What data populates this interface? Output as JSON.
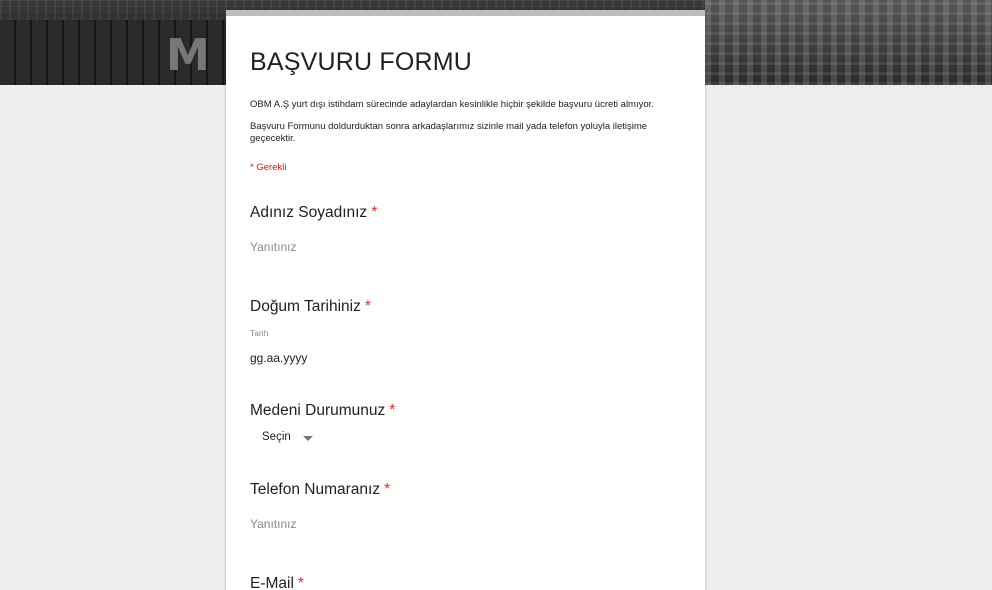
{
  "banner": {
    "letter": "M"
  },
  "form": {
    "title": "BAŞVURU FORMU",
    "description_1": "OBM A.Ş yurt dışı istihdam sürecinde adaylardan kesinlikle hiçbir şekilde başvuru ücreti almıyor.",
    "description_2": "Başvuru Formunu doldurduktan sonra arkadaşlarımız sizinle mail yada telefon yoluyla iletişime geçecektir.",
    "required_note": "* Gerekli",
    "required_marker": "*",
    "questions": [
      {
        "label": "Adınız Soyadınız",
        "placeholder": "Yanıtınız"
      },
      {
        "label": "Doğum Tarihiniz",
        "sublabel": "Tarih",
        "value": "gg.aa.yyyy"
      },
      {
        "label": "Medeni Durumunuz",
        "selected": "Seçin"
      },
      {
        "label": "Telefon Numaranız",
        "placeholder": "Yanıtınız"
      },
      {
        "label": "E-Mail"
      }
    ]
  },
  "colors": {
    "required": "#d93025",
    "page_bg": "#eeeeee",
    "card_bg": "#ffffff"
  }
}
